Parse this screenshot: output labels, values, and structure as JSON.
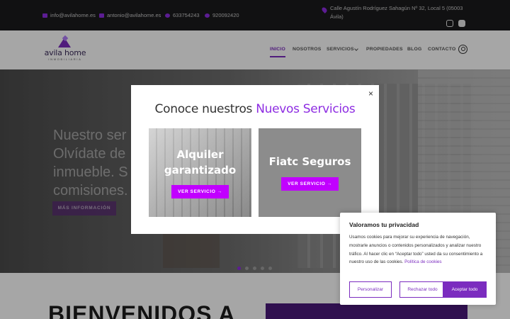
{
  "topbar": {
    "email1": "info@avilahome.es",
    "email2": "antonio@avilahome.es",
    "phone1": "633754243",
    "phone2": "920092420",
    "address": "Calle Agustín Rodríguez Sahagún Nº 32, Local 5 (05003 Ávila)",
    "social": [
      "instagram-icon",
      "facebook-icon"
    ]
  },
  "header": {
    "logo_text": "avila home",
    "logo_sub": "INMOBILIARIA",
    "nav": [
      {
        "label": "INICIO",
        "active": true
      },
      {
        "label": "NOSOTROS"
      },
      {
        "label": "SERVICIOS"
      },
      {
        "label": "PROPIEDADES"
      },
      {
        "label": "BLOG"
      },
      {
        "label": "CONTACTO"
      }
    ]
  },
  "hero": {
    "line1": "Nuestro ser",
    "line2": "Olvídate de",
    "line3": "inmueble. S",
    "line4": "comisiones.",
    "button": "MÁS INFORMACIÓN",
    "slides": 5,
    "active_slide": 0
  },
  "below": {
    "heading": "BIENVENIDOS A"
  },
  "modal": {
    "title_main": "Conoce nuestros ",
    "title_accent": "Nuevos Servicios",
    "close": "×",
    "cards": [
      {
        "title_l1": "Alquiler",
        "title_l2": "garantizado",
        "button": "VER SERVICIO  →"
      },
      {
        "title_l1": "Fiatc Seguros",
        "button": "VER SERVICIO  →"
      }
    ]
  },
  "cookie": {
    "title": "Valoramos tu privacidad",
    "text": "Usamos cookies para mejorar su experiencia de navegación, mostrarle anuncios o contenidos personalizados y analizar nuestro tráfico. Al hacer clic en “Aceptar todo” usted da su consentimiento a nuestro uso de las cookies. ",
    "link": "Política de cookies",
    "btn_customize": "Personalizar",
    "btn_reject": "Rechazar todo",
    "btn_accept": "Aceptar todo"
  },
  "colors": {
    "accent": "#8e2de2",
    "button_magenta": "#c100ff",
    "purple_dark": "#7b2cbf"
  }
}
